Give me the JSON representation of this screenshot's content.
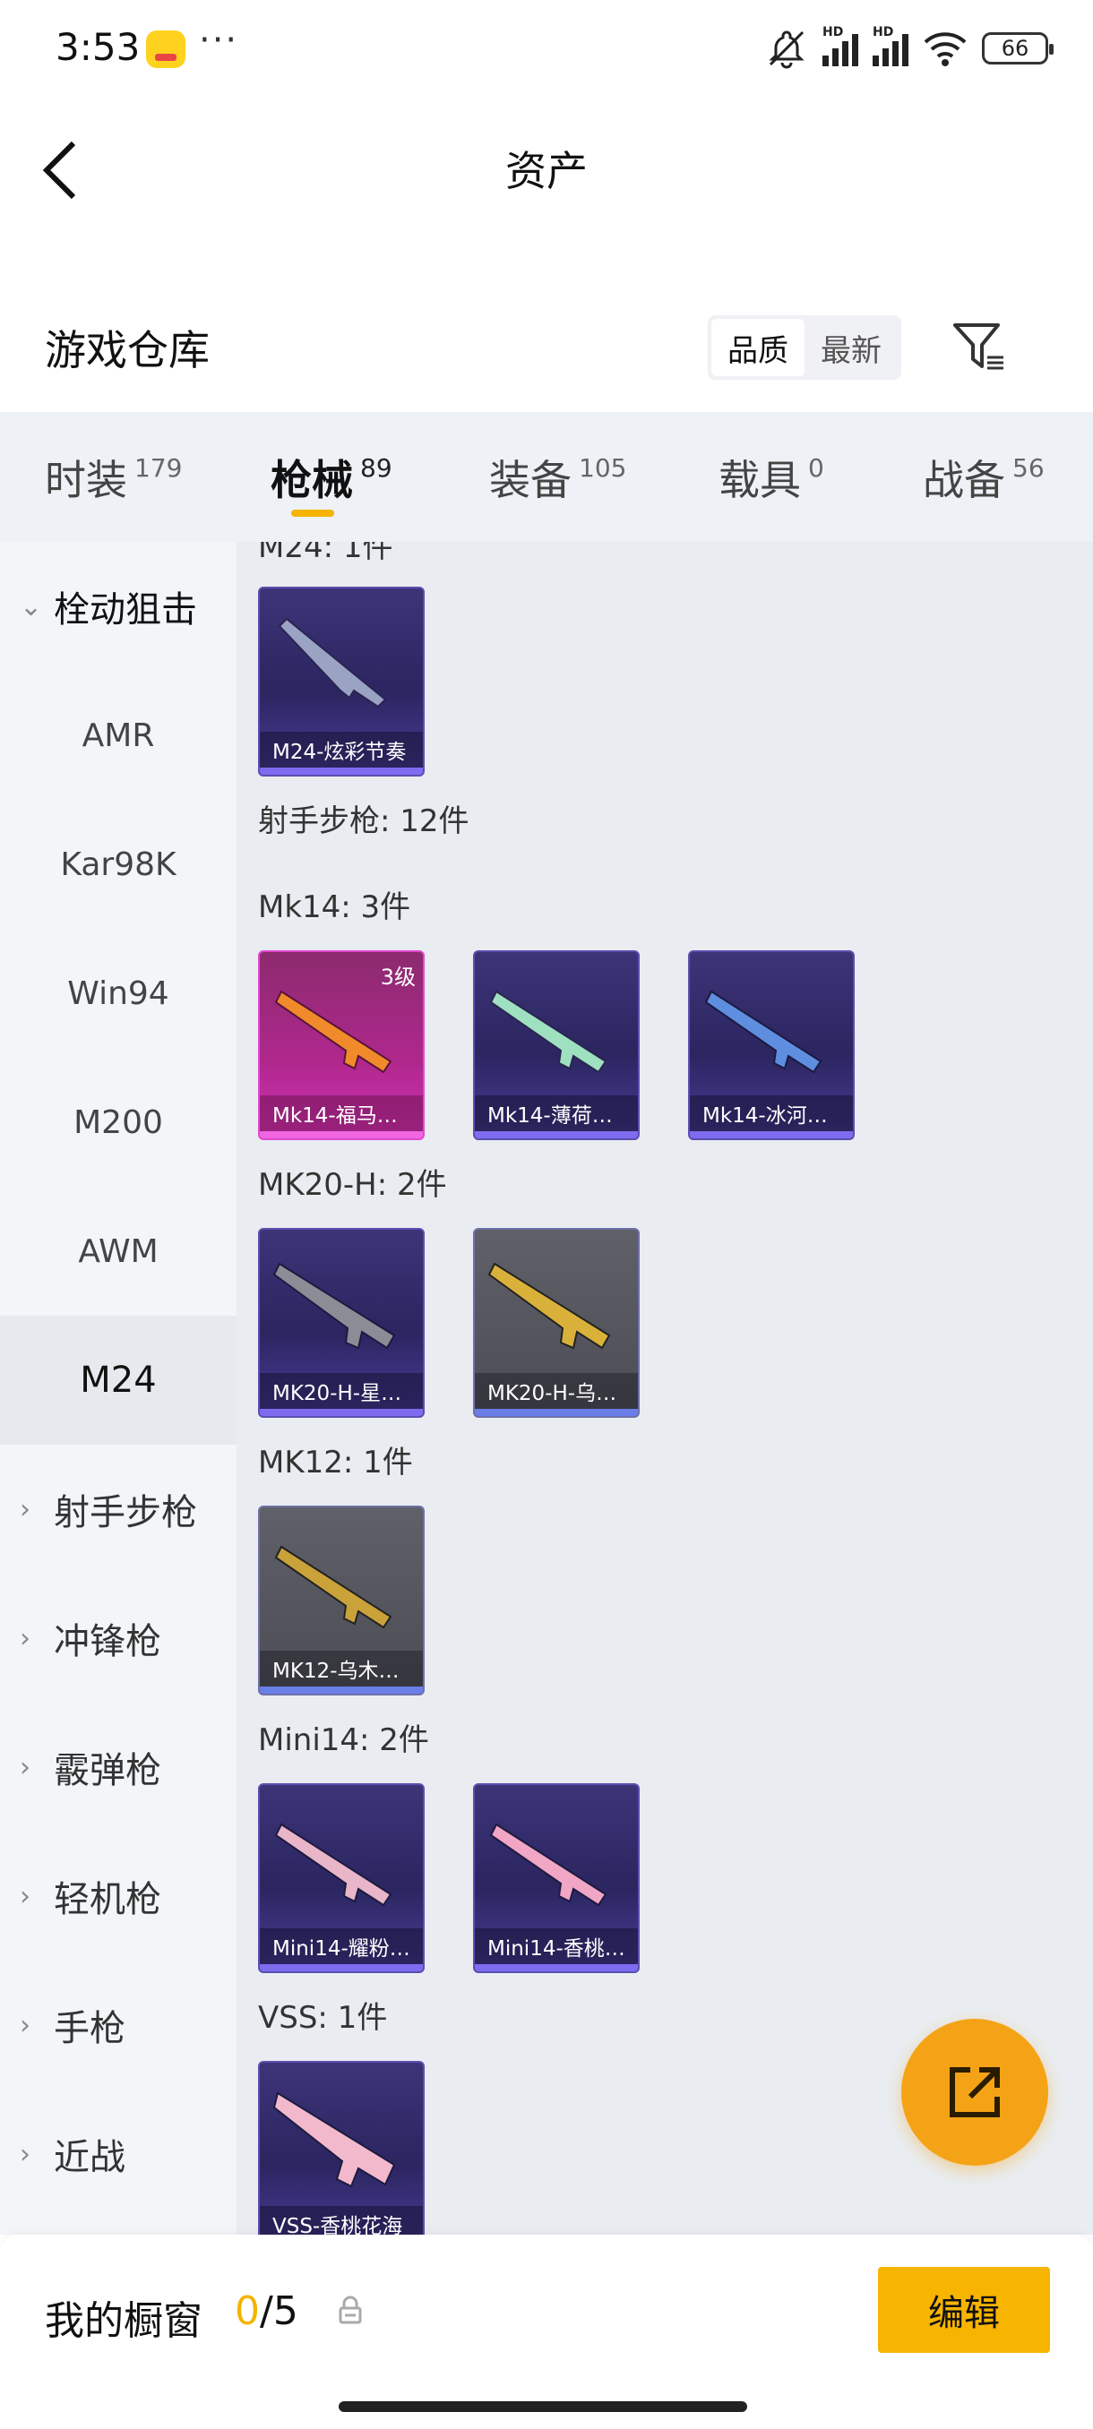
{
  "status_bar": {
    "time": "3:53",
    "dots": "···",
    "battery": "66",
    "hd1": "HD",
    "hd2": "HD"
  },
  "header": {
    "title": "资产"
  },
  "warehouse": {
    "title": "游戏仓库",
    "sort_options": [
      "品质",
      "最新"
    ],
    "active_sort": "品质"
  },
  "tabs": [
    {
      "label": "时装",
      "count": "179"
    },
    {
      "label": "枪械",
      "count": "89"
    },
    {
      "label": "装备",
      "count": "105"
    },
    {
      "label": "载具",
      "count": "0"
    },
    {
      "label": "战备",
      "count": "56"
    }
  ],
  "sidebar": {
    "group_expanded": "栓动狙击",
    "sub_items": [
      "AMR",
      "Kar98K",
      "Win94",
      "M200",
      "AWM",
      "M24"
    ],
    "selected": "M24",
    "groups": [
      "射手步枪",
      "冲锋枪",
      "霰弹枪",
      "轻机枪",
      "手枪",
      "近战"
    ]
  },
  "content": {
    "top_partial_header": "M24: 1件",
    "m24_item": "M24-炫彩节奏",
    "section_header": "射手步枪: 12件",
    "mk14_header": "Mk14: 3件",
    "mk14_items": [
      "Mk14-福马…",
      "Mk14-薄荷…",
      "Mk14-冰河…"
    ],
    "mk14_level": "3级",
    "mk20_header": "MK20-H: 2件",
    "mk20_items": [
      "MK20-H-星…",
      "MK20-H-乌…"
    ],
    "mk12_header": "MK12: 1件",
    "mk12_items": [
      "MK12-乌木…"
    ],
    "mini14_header": "Mini14: 2件",
    "mini14_items": [
      "Mini14-耀粉…",
      "Mini14-香桃…"
    ],
    "vss_header": "VSS: 1件",
    "vss_items": [
      "VSS-香桃花海"
    ]
  },
  "bottom_bar": {
    "label": "我的橱窗",
    "current": "0",
    "separator": "/",
    "total": "5",
    "edit_label": "编辑"
  },
  "colors": {
    "accent": "#f5b400",
    "fab": "#f5a316"
  }
}
